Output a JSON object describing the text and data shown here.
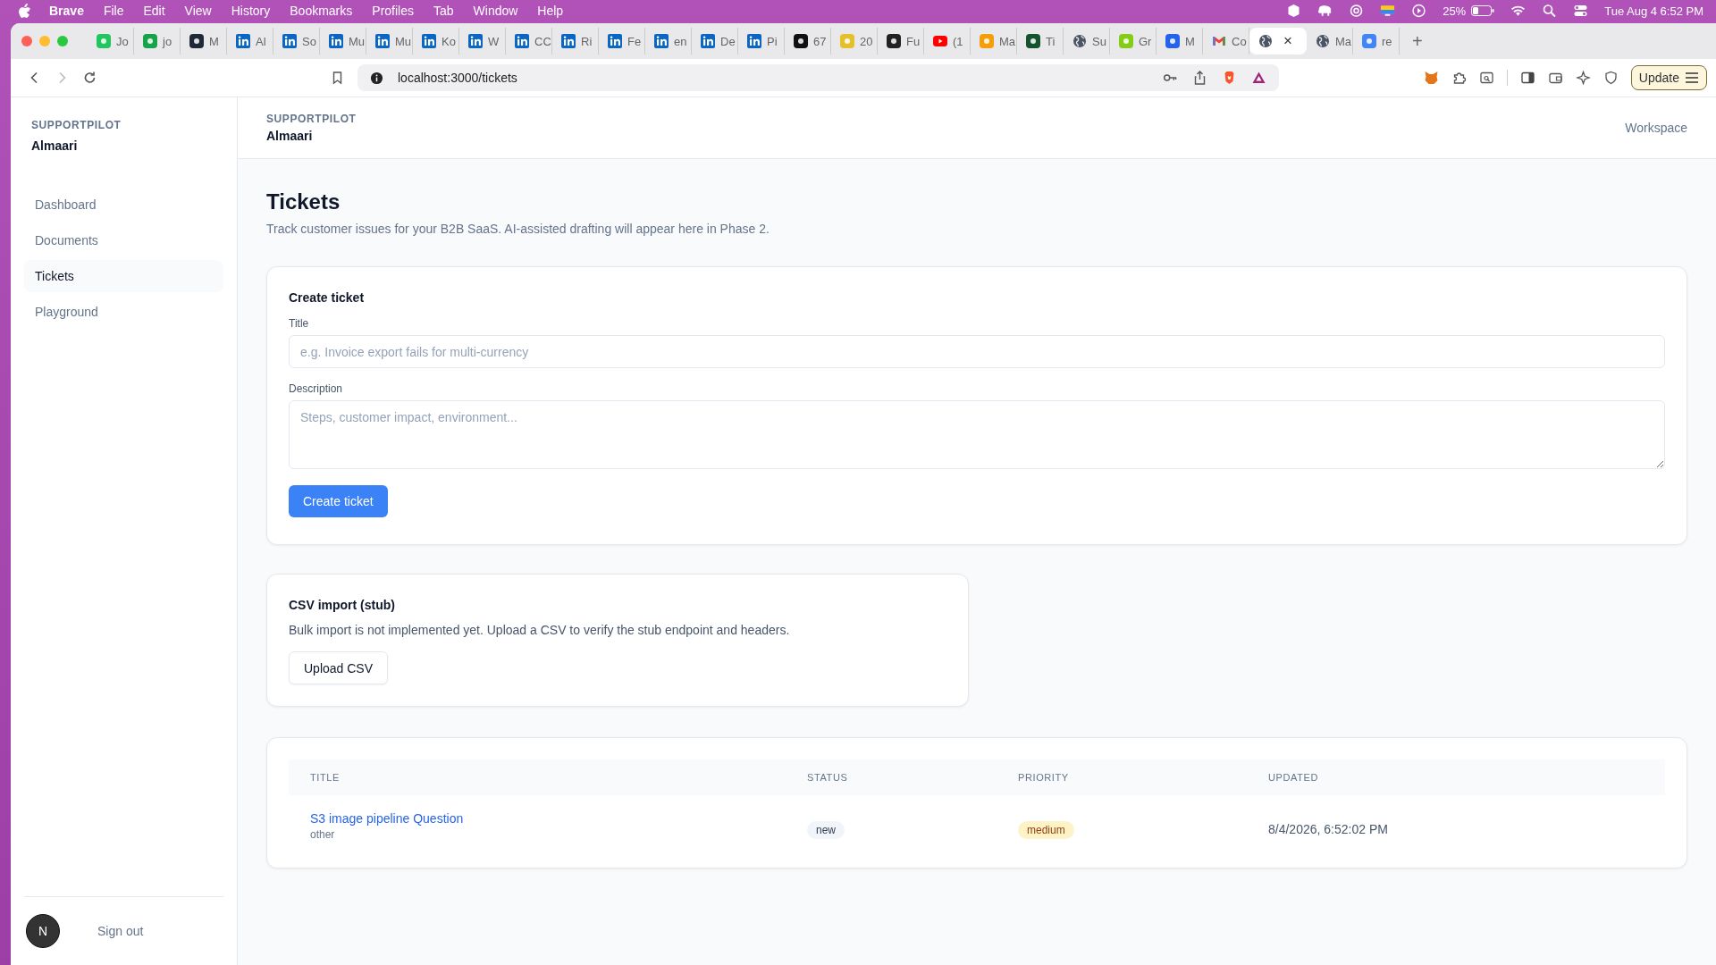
{
  "menu_bar": {
    "app": "Brave",
    "items": [
      "File",
      "Edit",
      "View",
      "History",
      "Bookmarks",
      "Profiles",
      "Tab",
      "Window",
      "Help"
    ],
    "battery": "25%",
    "clock": "Tue Aug 4  6:52 PM"
  },
  "tabs": [
    {
      "label": "Jo",
      "kind": "mark",
      "color": "#22c55e",
      "selected": false
    },
    {
      "label": "jo",
      "kind": "mark",
      "color": "#16a34a",
      "selected": false
    },
    {
      "label": "M",
      "kind": "mark",
      "color": "#1f2937",
      "selected": false
    },
    {
      "label": "Al",
      "kind": "linkedin",
      "selected": false
    },
    {
      "label": "So",
      "kind": "linkedin",
      "selected": false
    },
    {
      "label": "Mu",
      "kind": "linkedin",
      "selected": false
    },
    {
      "label": "Mu",
      "kind": "linkedin",
      "selected": false
    },
    {
      "label": "Ko",
      "kind": "linkedin",
      "selected": false
    },
    {
      "label": "W",
      "kind": "linkedin",
      "selected": false
    },
    {
      "label": "CC",
      "kind": "linkedin",
      "selected": false
    },
    {
      "label": "Ri",
      "kind": "linkedin",
      "selected": false
    },
    {
      "label": "Fe",
      "kind": "linkedin",
      "selected": false
    },
    {
      "label": "en",
      "kind": "linkedin",
      "selected": false
    },
    {
      "label": "De",
      "kind": "linkedin",
      "selected": false
    },
    {
      "label": "Pi",
      "kind": "linkedin",
      "selected": false
    },
    {
      "label": "67",
      "kind": "mark",
      "color": "#111111",
      "selected": false
    },
    {
      "label": "20",
      "kind": "mark",
      "color": "#e5c02a",
      "selected": false
    },
    {
      "label": "Fu",
      "kind": "mark",
      "color": "#222222",
      "selected": false
    },
    {
      "label": "(1",
      "kind": "video",
      "selected": false
    },
    {
      "label": "Ma",
      "kind": "mark",
      "color": "#f59e0b",
      "selected": false
    },
    {
      "label": "Ti",
      "kind": "mark",
      "color": "#14532d",
      "selected": false
    },
    {
      "label": "Su",
      "kind": "globe",
      "selected": false
    },
    {
      "label": "Gr",
      "kind": "mark",
      "color": "#84cc16",
      "selected": false
    },
    {
      "label": "M",
      "kind": "mark",
      "color": "#2563eb",
      "selected": false
    },
    {
      "label": "Co",
      "kind": "mail",
      "selected": false
    },
    {
      "close": "×",
      "kind": "globe",
      "selected": true
    },
    {
      "label": "Ma",
      "kind": "globe",
      "selected": false
    },
    {
      "label": "re",
      "kind": "mark",
      "color": "#4285f4",
      "selected": false
    }
  ],
  "new_tab": "+",
  "toolbar": {
    "url": "localhost:3000/tickets",
    "update_button": "Update"
  },
  "sidebar": {
    "brand": "SUPPORTPILOT",
    "workspace": "Almaari",
    "items": [
      {
        "label": "Dashboard",
        "selected": false
      },
      {
        "label": "Documents",
        "selected": false
      },
      {
        "label": "Tickets",
        "selected": true
      },
      {
        "label": "Playground",
        "selected": false
      }
    ],
    "avatar": "N",
    "sign_out": "Sign out"
  },
  "header": {
    "brand": "SUPPORTPILOT",
    "workspace": "Almaari",
    "link": "Workspace"
  },
  "page": {
    "title": "Tickets",
    "subtitle": "Track customer issues for your B2B SaaS. AI-assisted drafting will appear here in Phase 2."
  },
  "create_form": {
    "heading": "Create ticket",
    "title_label": "Title",
    "title_placeholder": "e.g. Invoice export fails for multi-currency",
    "description_label": "Description",
    "description_placeholder": "Steps, customer impact, environment...",
    "submit": "Create ticket"
  },
  "csv_import": {
    "heading": "CSV import (stub)",
    "text": "Bulk import is not implemented yet. Upload a CSV to verify the stub endpoint and headers.",
    "button": "Upload CSV"
  },
  "table": {
    "columns": [
      "TITLE",
      "STATUS",
      "PRIORITY",
      "UPDATED"
    ],
    "rows": [
      {
        "title": "S3 image pipeline Question",
        "category": "other",
        "status": "new",
        "priority": "medium",
        "updated": "8/4/2026, 6:52:02 PM"
      }
    ]
  }
}
